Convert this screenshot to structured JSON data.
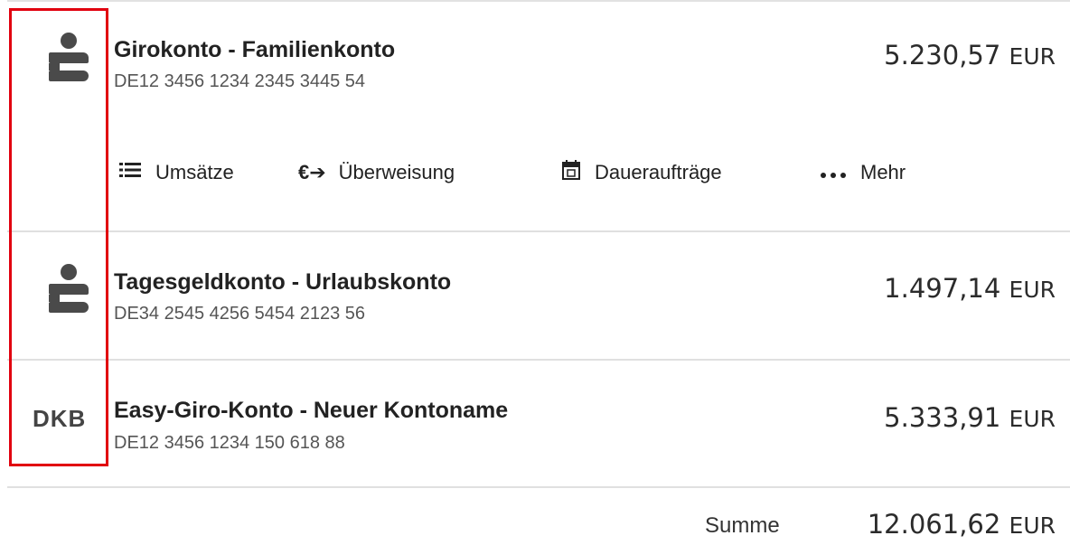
{
  "accounts": [
    {
      "logo": "sparkasse-logo",
      "name": "Girokonto - Familienkonto",
      "iban": "DE12 3456 1234 2345 3445 54",
      "amount": "5.230,57",
      "currency": "EUR"
    },
    {
      "logo": "sparkasse-logo",
      "name": "Tagesgeldkonto - Urlaubskonto",
      "iban": "DE34 2545 4256 5454 2123 56",
      "amount": "1.497,14",
      "currency": "EUR"
    },
    {
      "logo": "dkb-logo",
      "logo_text": "DKB",
      "name": "Easy-Giro-Konto - Neuer Kontoname",
      "iban": "DE12 3456 1234 150 618 88",
      "amount": "5.333,91",
      "currency": "EUR"
    }
  ],
  "actions": [
    {
      "icon": "list-icon",
      "label": "Umsätze"
    },
    {
      "icon": "euro-transfer-icon",
      "label": "Überweisung"
    },
    {
      "icon": "calendar-icon",
      "label": "Daueraufträge"
    },
    {
      "icon": "more-dots-icon",
      "label": "Mehr"
    }
  ],
  "summary": {
    "label": "Summe",
    "amount": "12.061,62",
    "currency": "EUR"
  },
  "colors": {
    "highlight_border": "#e1000f",
    "logo_gray": "#4a4a4a",
    "divider": "#e0e0e0"
  }
}
